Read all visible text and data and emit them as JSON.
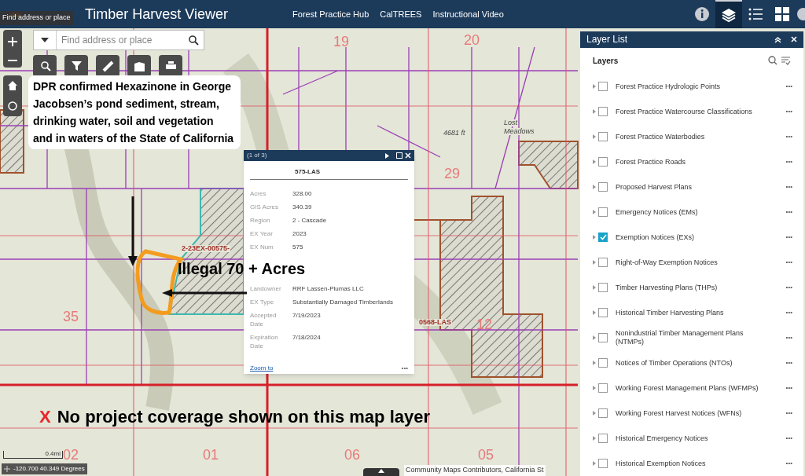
{
  "header": {
    "title": "Timber Harvest Viewer",
    "tooltip": "Find address or place",
    "links": [
      "Forest Practice Hub",
      "CalTREES",
      "Instructional Video"
    ],
    "tools": [
      {
        "kind": "info",
        "selected": false
      },
      {
        "kind": "layers",
        "selected": true
      },
      {
        "kind": "legend",
        "selected": false
      },
      {
        "kind": "basemap",
        "selected": false
      }
    ]
  },
  "search": {
    "placeholder": "Find address or place"
  },
  "map": {
    "labels": [
      {
        "text": "19",
        "kind": "section"
      },
      {
        "text": "20",
        "kind": "section"
      },
      {
        "text": "29",
        "kind": "section"
      },
      {
        "text": "35",
        "kind": "section"
      },
      {
        "text": "12",
        "kind": "section"
      },
      {
        "text": "02",
        "kind": "section"
      },
      {
        "text": "01",
        "kind": "section"
      },
      {
        "text": "06",
        "kind": "section"
      },
      {
        "text": "05",
        "kind": "section"
      },
      {
        "text": "4681 ft",
        "kind": "place"
      },
      {
        "text": "Lost",
        "kind": "place"
      },
      {
        "text": "Meadows",
        "kind": "place"
      },
      {
        "text": "2-23EX-00575-",
        "kind": "plan"
      },
      {
        "text": "0568-LAS",
        "kind": "plan"
      }
    ],
    "scale": "0.4mi",
    "coordinates": "-120.700 40.349 Degrees",
    "attribution": "Community Maps Contributors, California St"
  },
  "popup": {
    "counter": "(1 of 3)",
    "title": "575-LAS",
    "fields": [
      {
        "label": "Acres",
        "value": "328.00"
      },
      {
        "label": "GIS Acres",
        "value": "340.39"
      },
      {
        "label": "Region",
        "value": "2 - Cascade"
      },
      {
        "label": "EX Year",
        "value": "2023"
      },
      {
        "label": "EX Num",
        "value": "575"
      },
      {
        "label": "Landowner",
        "value": "RRF Lassen-Plumas LLC"
      },
      {
        "label": "EX Type",
        "value": "Substantially Damaged Timberlands"
      },
      {
        "label": "Accepted Date",
        "value": "7/19/2023"
      },
      {
        "label": "Expiration Date",
        "value": "7/18/2024"
      }
    ],
    "zoom_link": "Zoom to",
    "more": "•••"
  },
  "annotations": {
    "callout": "DPR confirmed Hexazinone in George Jacobsen’s pond sediment, stream, drinking water, soil and vegetation and in waters of the State of California",
    "acres": "Illegal 70 + Acres",
    "mark": "X",
    "note": "No project coverage shown on this map layer"
  },
  "layer_list": {
    "title": "Layer List",
    "heading": "Layers",
    "layers": [
      {
        "name": "Forest Practice Hydrologic Points",
        "checked": false
      },
      {
        "name": "Forest Practice Watercourse Classifications",
        "checked": false
      },
      {
        "name": "Forest Practice Waterbodies",
        "checked": false
      },
      {
        "name": "Forest Practice Roads",
        "checked": false
      },
      {
        "name": "Proposed Harvest Plans",
        "checked": false
      },
      {
        "name": "Emergency Notices (EMs)",
        "checked": false
      },
      {
        "name": "Exemption Notices (EXs)",
        "checked": true
      },
      {
        "name": "Right-of-Way Exemption Notices",
        "checked": false
      },
      {
        "name": "Timber Harvesting Plans (THPs)",
        "checked": false
      },
      {
        "name": "Historical Timber Harvesting Plans",
        "checked": false
      },
      {
        "name": "Nonindustrial Timber Management Plans (NTMPs)",
        "checked": false
      },
      {
        "name": "Notices of Timber Operations (NTOs)",
        "checked": false
      },
      {
        "name": "Working Forest Management Plans (WFMPs)",
        "checked": false
      },
      {
        "name": "Working Forest Harvest Notices (WFNs)",
        "checked": false
      },
      {
        "name": "Historical Emergency Notices",
        "checked": false
      },
      {
        "name": "Historical Exemption Notices",
        "checked": false
      }
    ],
    "more": "•••"
  }
}
